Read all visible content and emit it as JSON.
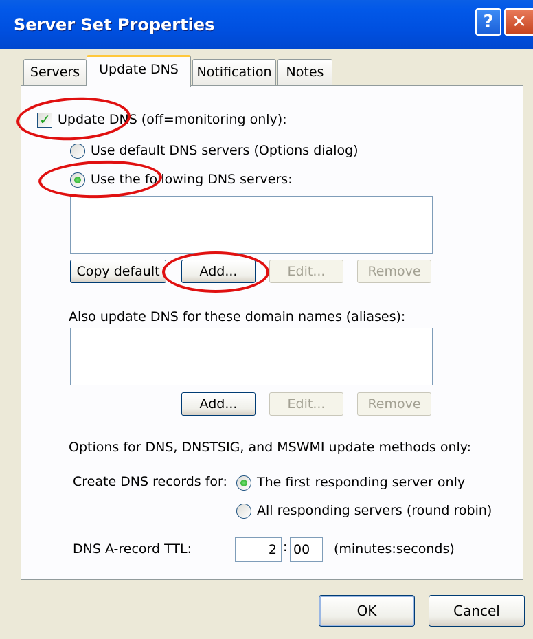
{
  "window": {
    "title": "Server Set Properties",
    "help_glyph": "?",
    "close_glyph": "✕"
  },
  "tabs": [
    {
      "label": "Servers"
    },
    {
      "label": "Update DNS"
    },
    {
      "label": "Notification"
    },
    {
      "label": "Notes"
    }
  ],
  "update_dns": {
    "checkbox_label": "Update DNS  (off=monitoring only):",
    "checked": true,
    "radio_default_label": "Use default DNS servers (Options dialog)",
    "radio_following_label": "Use the following DNS servers:",
    "selected_radio": "following",
    "dns_servers_list": [],
    "copy_default_label": "Copy default",
    "add_label": "Add...",
    "edit_label": "Edit...",
    "remove_label": "Remove",
    "aliases_label": "Also update DNS for these domain names (aliases):",
    "aliases_list": [],
    "aliases_add_label": "Add...",
    "aliases_edit_label": "Edit...",
    "aliases_remove_label": "Remove",
    "options_heading": "Options for DNS, DNSTSIG, and MSWMI update methods only:",
    "create_records_label": "Create DNS records for:",
    "create_first_label": "The first responding server only",
    "create_all_label": "All responding servers (round robin)",
    "create_selected": "first",
    "ttl_label": "DNS A-record TTL:",
    "ttl_minutes": "2",
    "ttl_separator": ":",
    "ttl_seconds": "00",
    "ttl_units": "(minutes:seconds)"
  },
  "footer": {
    "ok_label": "OK",
    "cancel_label": "Cancel"
  },
  "colors": {
    "titlebar": "#0050e0",
    "highlight_ring": "#e01010",
    "dialog_bg": "#ece9d8"
  }
}
